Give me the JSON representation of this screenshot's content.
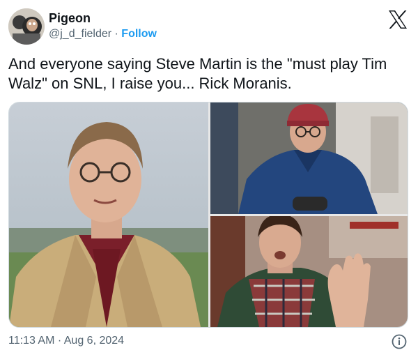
{
  "author": {
    "name": "Pigeon",
    "handle": "@j_d_fielder",
    "separator": " · ",
    "follow_label": "Follow"
  },
  "tweet": {
    "text": "And everyone saying Steve Martin is the \"must play Tim Walz\" on SNL, I raise you... Rick Moranis."
  },
  "media": {
    "images": [
      {
        "name": "photo-man-tan-blazer"
      },
      {
        "name": "photo-man-red-beanie"
      },
      {
        "name": "photo-man-plaid-shirt"
      }
    ]
  },
  "timestamp": "11:13 AM · Aug 6, 2024",
  "icons": {
    "logo": "x-logo-icon",
    "info": "info-icon"
  },
  "colors": {
    "accent": "#1d9bf0",
    "secondary_text": "#536471",
    "primary_text": "#0f1419",
    "border": "#cfd9de"
  }
}
